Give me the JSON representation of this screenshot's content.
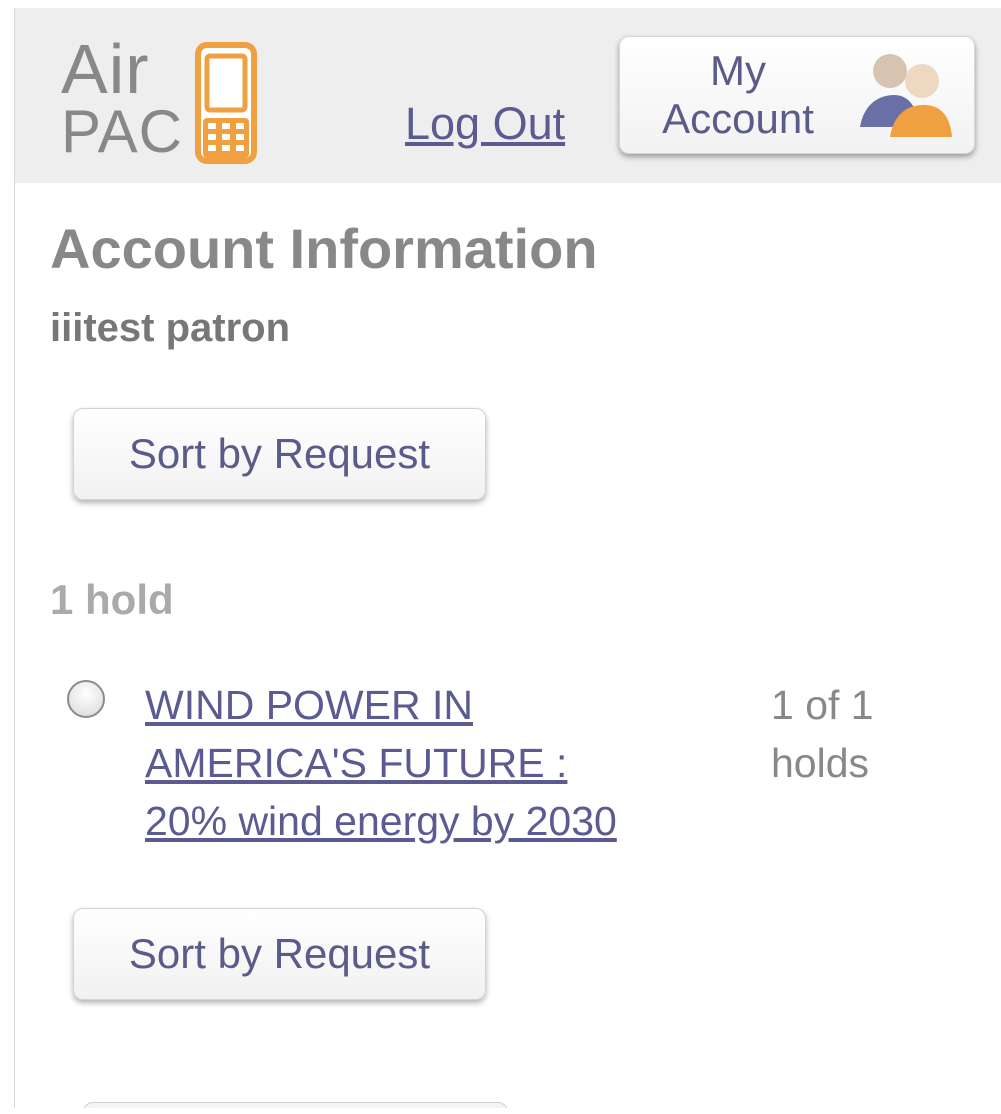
{
  "header": {
    "logo": {
      "line1": "Air",
      "line2": "PAC",
      "phone_icon": "mobile-phone-icon",
      "accent_color": "#f0a040"
    },
    "logout_label": "Log Out",
    "my_account": {
      "label": "My\nAccount",
      "icon": "people-icon"
    }
  },
  "main": {
    "title": "Account Information",
    "patron_name": "iiitest patron",
    "sort_label_top": "Sort by Request",
    "hold_count": "1 hold",
    "holds": [
      {
        "title": "WIND POWER IN\nAMERICA'S FUTURE :\n20% wind energy by 2030",
        "position": "1 of 1\nholds",
        "checked": false
      }
    ],
    "sort_label_bottom": "Sort by Request"
  },
  "colors": {
    "link": "#5b5b92",
    "muted_text": "#888888",
    "header_bg": "#eeeeee",
    "accent_orange": "#f0a040",
    "accent_blue": "#6b6fa8"
  }
}
